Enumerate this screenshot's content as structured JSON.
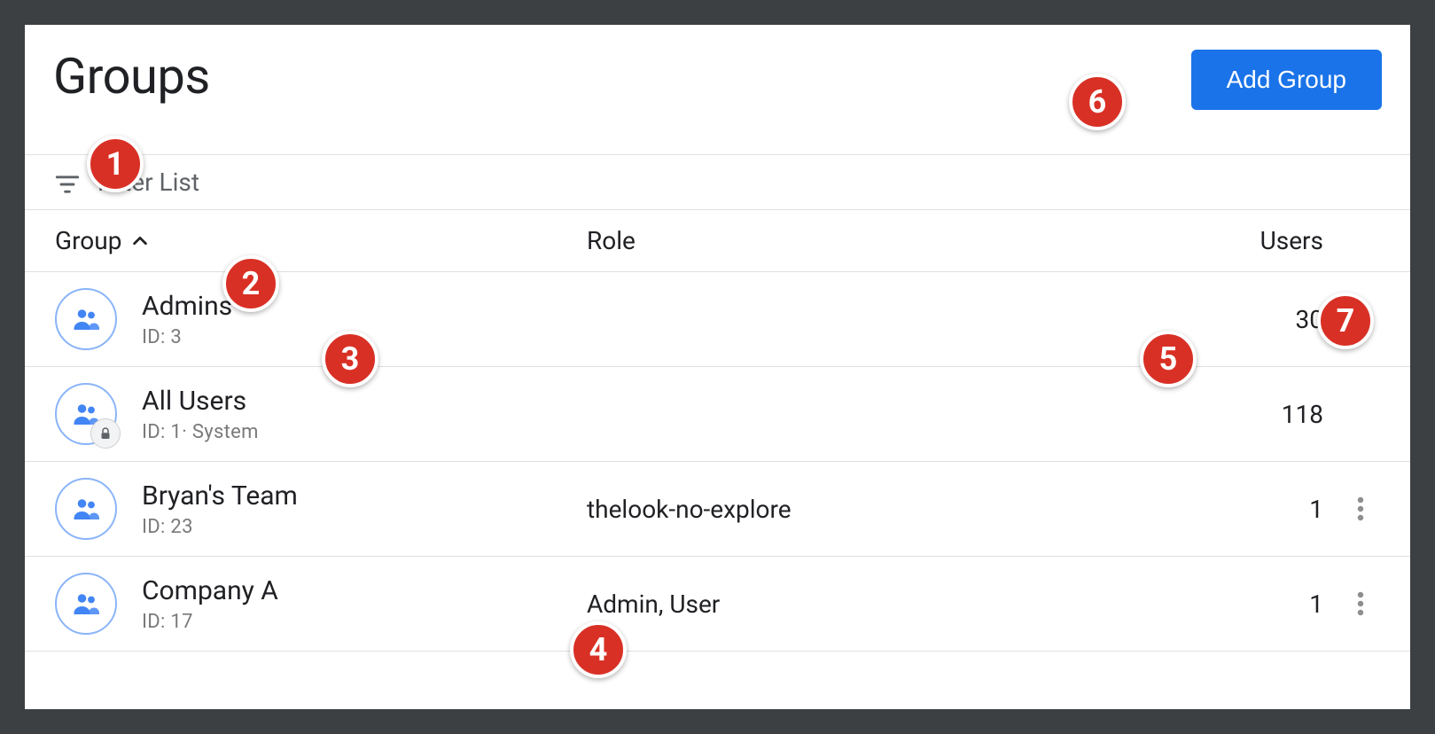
{
  "page": {
    "title": "Groups",
    "add_button_label": "Add Group",
    "filter_label": "Filter List"
  },
  "columns": {
    "group": "Group",
    "role": "Role",
    "users": "Users"
  },
  "rows": [
    {
      "name": "Admins",
      "sub": "ID: 3",
      "role": "",
      "users": "30",
      "locked": false,
      "kebab": true
    },
    {
      "name": "All Users",
      "sub": "ID: 1· System",
      "role": "",
      "users": "118",
      "locked": true,
      "kebab": false
    },
    {
      "name": "Bryan's Team",
      "sub": "ID: 23",
      "role": "thelook-no-explore",
      "users": "1",
      "locked": false,
      "kebab": true
    },
    {
      "name": "Company A",
      "sub": "ID: 17",
      "role": "Admin, User",
      "users": "1",
      "locked": false,
      "kebab": true
    }
  ],
  "callouts": {
    "1": "1",
    "2": "2",
    "3": "3",
    "4": "4",
    "5": "5",
    "6": "6",
    "7": "7"
  }
}
